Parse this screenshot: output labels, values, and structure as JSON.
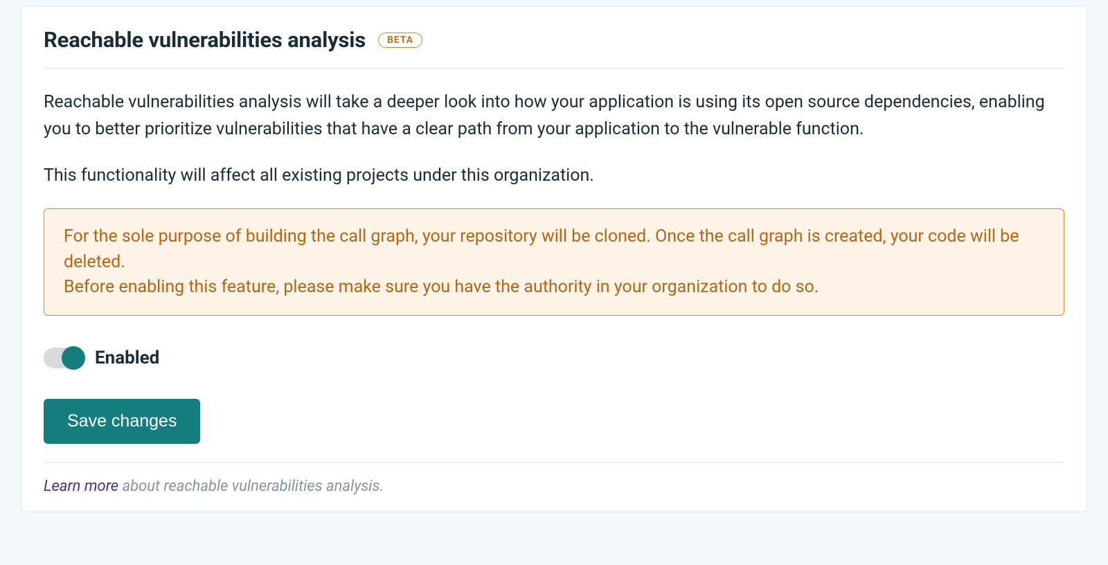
{
  "header": {
    "title": "Reachable vulnerabilities analysis",
    "badge": "BETA"
  },
  "description": {
    "p1": "Reachable vulnerabilities analysis will take a deeper look into how your application is using its open source dependencies, enabling you to better prioritize vulnerabilities that have a clear path from your application to the vulnerable function.",
    "p2": "This functionality will affect all existing projects under this organization."
  },
  "warning": {
    "p1": "For the sole purpose of building the call graph, your repository will be cloned. Once the call graph is created, your code will be deleted.",
    "p2": "Before enabling this feature, please make sure you have the authority in your organization to do so."
  },
  "toggle": {
    "label": "Enabled",
    "state": "on"
  },
  "actions": {
    "save": "Save changes"
  },
  "footer": {
    "learn_more": "Learn more",
    "rest": " about reachable vulnerabilities analysis."
  }
}
